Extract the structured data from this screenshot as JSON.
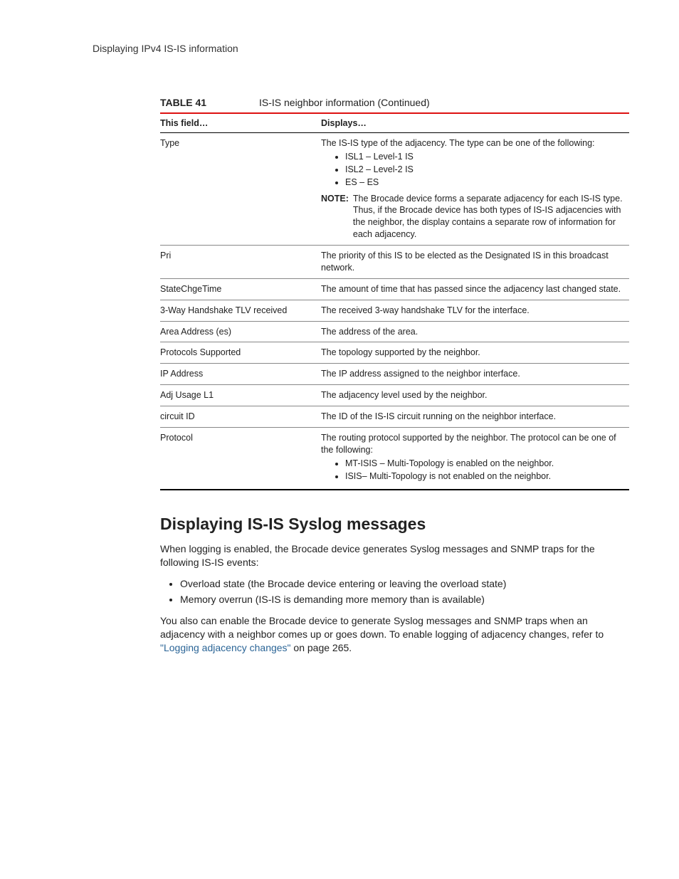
{
  "header": {
    "running": "Displaying IPv4 IS-IS information"
  },
  "table": {
    "label": "TABLE 41",
    "title": "IS-IS neighbor information (Continued)",
    "head": {
      "col1": "This field…",
      "col2": "Displays…"
    },
    "rows": {
      "type": {
        "field": "Type",
        "intro": "The IS-IS type of the adjacency. The type can be one of the following:",
        "items": [
          "ISL1 – Level-1 IS",
          "ISL2 – Level-2 IS",
          "ES – ES"
        ],
        "note_label": "NOTE:",
        "note_text": "The Brocade device forms a separate adjacency for each IS-IS type. Thus, if the Brocade device has both types of IS-IS adjacencies with the neighbor, the display contains a separate row of information for each adjacency."
      },
      "pri": {
        "field": "Pri",
        "desc": "The priority of this IS to be elected as the Designated IS in this broadcast network."
      },
      "state": {
        "field": "StateChgeTime",
        "desc": "The amount of time that has passed since the adjacency last changed state."
      },
      "hand": {
        "field": "3-Way Handshake TLV received",
        "desc": "The received 3-way handshake TLV for the interface."
      },
      "area": {
        "field": "Area Address (es)",
        "desc": "The address of the area."
      },
      "proto_sup": {
        "field": "Protocols Supported",
        "desc": "The topology supported by the neighbor."
      },
      "ip": {
        "field": "IP Address",
        "desc": "The IP address assigned to the neighbor interface."
      },
      "adj": {
        "field": "Adj Usage L1",
        "desc": "The adjacency level used by the neighbor."
      },
      "circuit": {
        "field": "circuit ID",
        "desc": "The ID of the IS-IS circuit running on the neighbor interface."
      },
      "protocol": {
        "field": "Protocol",
        "intro": "The routing protocol supported by the neighbor. The protocol can be one of the following:",
        "items": [
          "MT-ISIS – Multi-Topology is enabled on the neighbor.",
          "ISIS– Multi-Topology is not enabled on the neighbor."
        ]
      }
    }
  },
  "section": {
    "heading": "Displaying IS-IS Syslog messages",
    "p1": "When logging is enabled, the Brocade device generates Syslog messages and SNMP traps for the following IS-IS events:",
    "bullets": [
      "Overload state (the Brocade device entering or leaving the overload state)",
      "Memory overrun (IS-IS is demanding more memory than is available)"
    ],
    "p2a": "You also can enable the Brocade device to generate Syslog messages and SNMP traps when an adjacency with a neighbor comes up or goes down. To enable logging of adjacency changes, refer to ",
    "link": "\"Logging adjacency changes\"",
    "p2b": " on page 265."
  }
}
